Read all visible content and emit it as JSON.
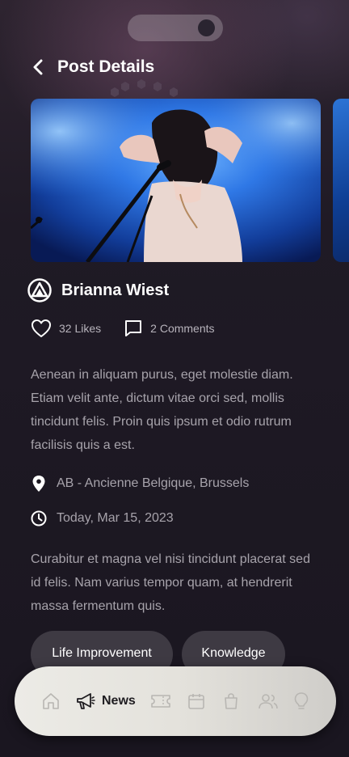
{
  "header": {
    "title": "Post Details"
  },
  "post": {
    "author": "Brianna Wiest",
    "likes": "32 Likes",
    "comments": "2 Comments",
    "description": "Aenean in aliquam purus, eget molestie diam. Etiam velit ante, dictum vitae orci sed, mollis tincidunt felis. Proin quis ipsum et odio rutrum facilisis quis a est.",
    "location": "AB - Ancienne Belgique, Brussels",
    "date": "Today, Mar 15, 2023",
    "body": "Curabitur et magna vel nisi tincidunt placerat sed id felis. Nam varius tempor quam, at hendrerit massa fermentum quis.",
    "tags": [
      "Life Improvement",
      "Knowledge"
    ]
  },
  "nav": {
    "active_label": "News",
    "items": [
      "home-icon",
      "megaphone-icon",
      "ticket-icon",
      "calendar-icon",
      "shopping-bag-icon",
      "people-icon",
      "lightbulb-icon"
    ]
  },
  "colors": {
    "background": "#1b1720",
    "text_secondary": "#a7a3ab",
    "tag_background": "#3e3a43",
    "nav_background": "#e4e2dc",
    "photo_blue": "#1f5fd0"
  }
}
